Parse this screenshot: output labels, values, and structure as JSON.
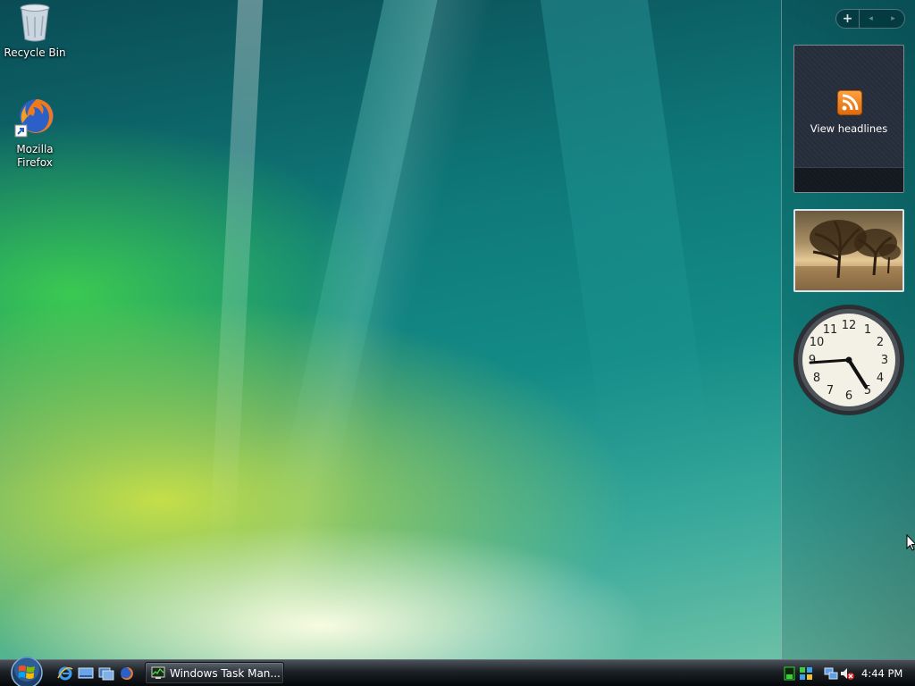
{
  "desktop": {
    "icons": [
      {
        "label": "Recycle Bin",
        "icon": "recycle-bin-icon"
      },
      {
        "label": "Mozilla Firefox",
        "icon": "firefox-icon"
      }
    ]
  },
  "sidebar": {
    "controls": {
      "add_label": "+",
      "prev_label": "◂",
      "next_label": "▸"
    },
    "feed_gadget": {
      "label": "View headlines",
      "icon": "rss-icon"
    },
    "slideshow_gadget": {
      "subject": "trees-at-sunset"
    },
    "clock_gadget": {
      "numerals": [
        "12",
        "1",
        "2",
        "3",
        "4",
        "5",
        "6",
        "7",
        "8",
        "9",
        "10",
        "11"
      ],
      "time": "4:44"
    }
  },
  "taskbar": {
    "quick_launch": [
      {
        "icon": "internet-explorer-icon"
      },
      {
        "icon": "show-desktop-icon"
      },
      {
        "icon": "switch-windows-icon"
      },
      {
        "icon": "firefox-icon"
      }
    ],
    "task_button_label": "Windows Task Man...",
    "tray_icons": [
      "cpu-meter-icon",
      "status-icon",
      "network-icon",
      "volume-muted-icon"
    ],
    "clock": "4:44 PM"
  },
  "colors": {
    "accent_orange": "#f08a24",
    "taskbar_dark": "#1c2126"
  }
}
